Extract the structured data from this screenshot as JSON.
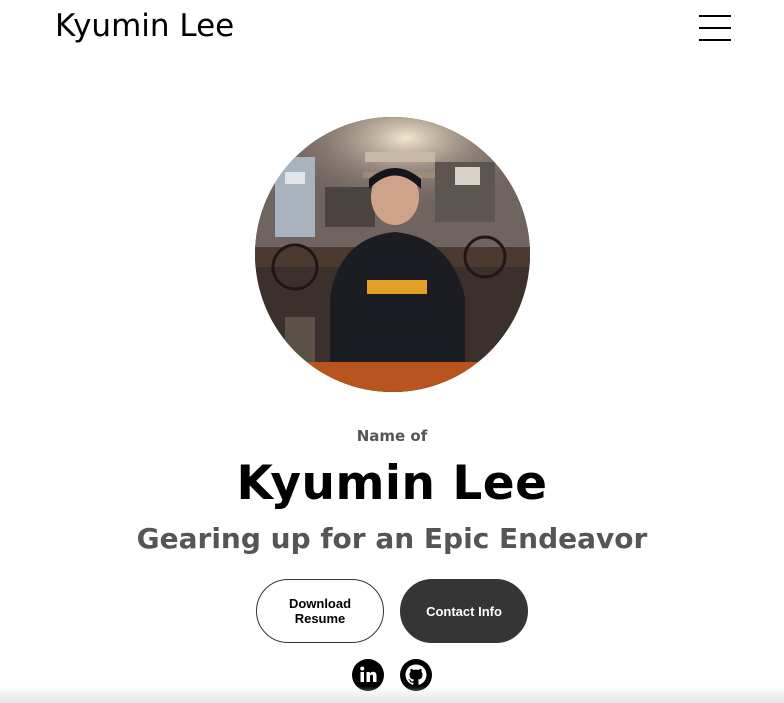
{
  "nav": {
    "logo": "Kyumin Lee",
    "menu_icon": "hamburger-menu-icon"
  },
  "profile": {
    "photo_icon": "profile-photo",
    "pretitle": "Name of",
    "name": "Kyumin Lee",
    "tagline": "Gearing up for an Epic Endeavor"
  },
  "buttons": {
    "resume_label_line1": "Download",
    "resume_label_line2": "Resume",
    "contact_label": "Contact Info"
  },
  "social": {
    "linkedin_icon": "linkedin-icon",
    "github_icon": "github-icon"
  },
  "colors": {
    "text_primary": "#000000",
    "text_secondary": "#555555",
    "contact_button_bg": "#353535"
  }
}
